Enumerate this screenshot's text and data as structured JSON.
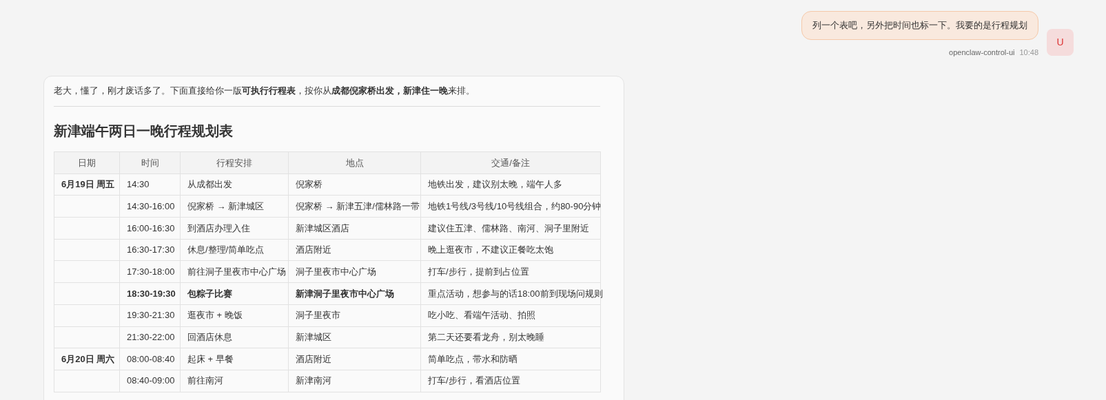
{
  "user_message": {
    "text": "列一个表吧，另外把时间也标一下。我要的是行程规划",
    "sender": "openclaw-control-ui",
    "time": "10:48",
    "avatar": "U"
  },
  "assistant_message": {
    "intro": "老大，懂了，刚才废话多了。下面直接给你一版**可执行行程表**，按你从**成都倪家桥出发，新津住一晚**来排。",
    "heading": "新津端午两日一晚行程规划表",
    "table": {
      "columns": [
        "日期",
        "时间",
        "行程安排",
        "地点",
        "交通/备注"
      ],
      "rows": [
        {
          "date": "6月19日 周五",
          "time": "14:30",
          "activity": "从成都出发",
          "place": "倪家桥",
          "note": "地铁出发，建议别太晚，端午人多",
          "emphasis": false
        },
        {
          "time": "14:30-16:00",
          "activity": "倪家桥 → 新津城区",
          "place": "倪家桥 → 新津五津/儒林路一带",
          "note": "地铁1号线/3号线/10号线组合，约80-90分钟",
          "emphasis": false
        },
        {
          "time": "16:00-16:30",
          "activity": "到酒店办理入住",
          "place": "新津城区酒店",
          "note": "建议住五津、儒林路、南河、洞子里附近",
          "emphasis": false
        },
        {
          "time": "16:30-17:30",
          "activity": "休息/整理/简单吃点",
          "place": "酒店附近",
          "note": "晚上逛夜市，不建议正餐吃太饱",
          "emphasis": false
        },
        {
          "time": "17:30-18:00",
          "activity": "前往洞子里夜市中心广场",
          "place": "洞子里夜市中心广场",
          "note": "打车/步行，提前到占位置",
          "emphasis": false
        },
        {
          "time": "18:30-19:30",
          "activity": "包粽子比赛",
          "place": "新津洞子里夜市中心广场",
          "note": "重点活动，想参与的话18:00前到现场问规则",
          "emphasis": true
        },
        {
          "time": "19:30-21:30",
          "activity": "逛夜市 + 晚饭",
          "place": "洞子里夜市",
          "note": "吃小吃、看端午活动、拍照",
          "emphasis": false
        },
        {
          "time": "21:30-22:00",
          "activity": "回酒店休息",
          "place": "新津城区",
          "note": "第二天还要看龙舟，别太晚睡",
          "emphasis": false
        },
        {
          "date": "6月20日 周六",
          "time": "08:00-08:40",
          "activity": "起床 + 早餐",
          "place": "酒店附近",
          "note": "简单吃点，带水和防晒",
          "emphasis": false
        },
        {
          "time": "08:40-09:00",
          "activity": "前往南河",
          "place": "新津南河",
          "note": "打车/步行，看酒店位置",
          "emphasis": false
        }
      ]
    }
  }
}
